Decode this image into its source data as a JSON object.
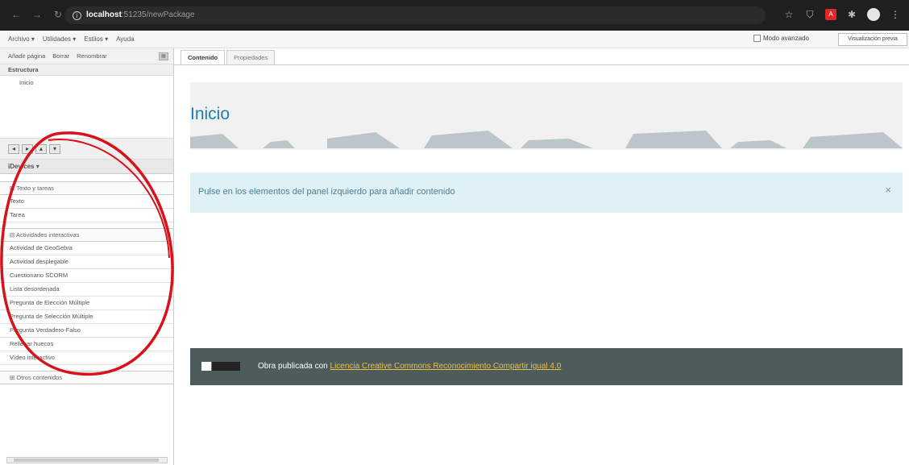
{
  "browser": {
    "url_host": "localhost",
    "url_port": ":51235",
    "url_path": "/newPackage"
  },
  "menubar": {
    "items": [
      "Archivo ▾",
      "Utilidades ▾",
      "Estilos ▾",
      "Ayuda"
    ],
    "advanced_mode_label": "Modo avanzado",
    "preview_button": "Visualización previa"
  },
  "structure": {
    "toolbar": [
      "Añadir página",
      "Borrar",
      "Renombrar"
    ],
    "title": "Estructura",
    "nodes": [
      "Inicio"
    ]
  },
  "idevices": {
    "title": "iDevices ▾",
    "categories": [
      {
        "label": "⊟ Texto y tareas",
        "items": [
          "Texto",
          "Tarea"
        ]
      },
      {
        "label": "⊟ Actividades interactivas",
        "items": [
          "Actividad de GeoGebra",
          "Actividad desplegable",
          "Cuestionario SCORM",
          "Lista desordenada",
          "Pregunta de Elección Múltiple",
          "Pregunta de Selección Múltiple",
          "Pregunta Verdadero-Falso",
          "Rellenar huecos",
          "Vídeo interactivo"
        ]
      },
      {
        "label": "⊞ Otros contenidos",
        "items": []
      }
    ]
  },
  "tabs": [
    "Contenido",
    "Propiedades"
  ],
  "content": {
    "page_title": "Inicio",
    "hint": "Pulse en los elementos del panel izquierdo para añadir contenido",
    "close_symbol": "×",
    "footer_text": "Obra publicada con ",
    "footer_link": "Licencia Creative Commons Reconocimiento Compartir igual 4.0"
  },
  "colors": {
    "title_blue": "#1b7fb0",
    "alert_bg": "#dff0f7",
    "footer_bg": "#4c5b5c",
    "annotation_red": "#d8121b"
  }
}
